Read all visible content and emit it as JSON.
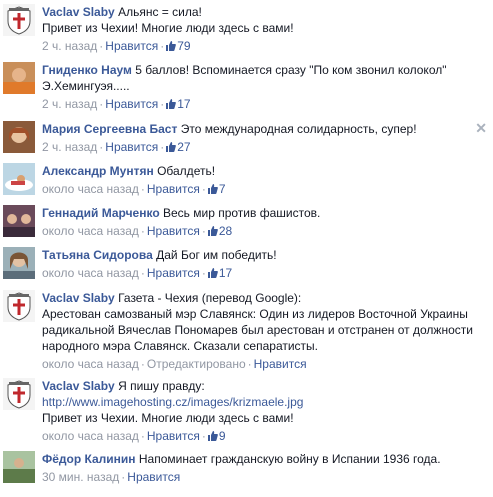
{
  "comments": [
    {
      "avatar": "shield-logo-avatar",
      "author": "Vaclav Slaby",
      "lines": [
        "Альянс = сила!",
        "Привет из Чехии! Многие люди здесь с вами!"
      ],
      "time": "2 ч. назад",
      "like": "Нравится",
      "count": "79"
    },
    {
      "avatar": "photo-avatar",
      "author": "Гниденко Наум",
      "lines": [
        "5 баллов! Вспоминается сразу \"По ком звонил колокол\"",
        "Э.Хемингуэя....."
      ],
      "time": "2 ч. назад",
      "like": "Нравится",
      "count": "17"
    },
    {
      "avatar": "photo-avatar",
      "author": "Мария Сергеевна Баст",
      "lines": [
        "Это международная солидарность, супер!"
      ],
      "time": "2 ч. назад",
      "like": "Нравится",
      "count": "27"
    },
    {
      "avatar": "photo-avatar",
      "author": "Александр Мунтян",
      "lines": [
        "Обалдеть!"
      ],
      "time": "около часа назад",
      "like": "Нравится",
      "count": "7"
    },
    {
      "avatar": "photo-avatar",
      "author": "Геннадий Марченко",
      "lines": [
        "Весь мир против фашистов."
      ],
      "time": "около часа назад",
      "like": "Нравится",
      "count": "28"
    },
    {
      "avatar": "photo-avatar",
      "author": "Татьяна Сидорова",
      "lines": [
        "Дай Бог им победить!"
      ],
      "time": "около часа назад",
      "like": "Нравится",
      "count": "17"
    },
    {
      "avatar": "shield-logo-avatar",
      "author": "Vaclav Slaby",
      "lines": [
        "Газета - Чехия (перевод Google):",
        "Арестован самозваный мэр Славянск: Один из лидеров Восточной Украины",
        "радикальной Вячеслав Пономарев был арестован и отстранен от должности",
        "народного мэра Славянск. Сказали сепаратисты."
      ],
      "time": "около часа назад",
      "edited": "Отредактировано",
      "like": "Нравится"
    },
    {
      "avatar": "shield-logo-avatar",
      "author": "Vaclav Slaby",
      "lines": [
        "Я пишу правду:"
      ],
      "link": "http://www.imagehosting.cz/images/krizmaele.jpg",
      "extra": "Привет из Чехии. Многие люди здесь с вами!",
      "time": "около часа назад",
      "like": "Нравится",
      "count": "9"
    },
    {
      "avatar": "photo-avatar",
      "author": "Фёдор Калинин",
      "lines": [
        "Напоминает гражданскую войну в Испании 1936 года."
      ],
      "time": "30 мин. назад",
      "like": "Нравится"
    }
  ],
  "close_glyph": "✕"
}
